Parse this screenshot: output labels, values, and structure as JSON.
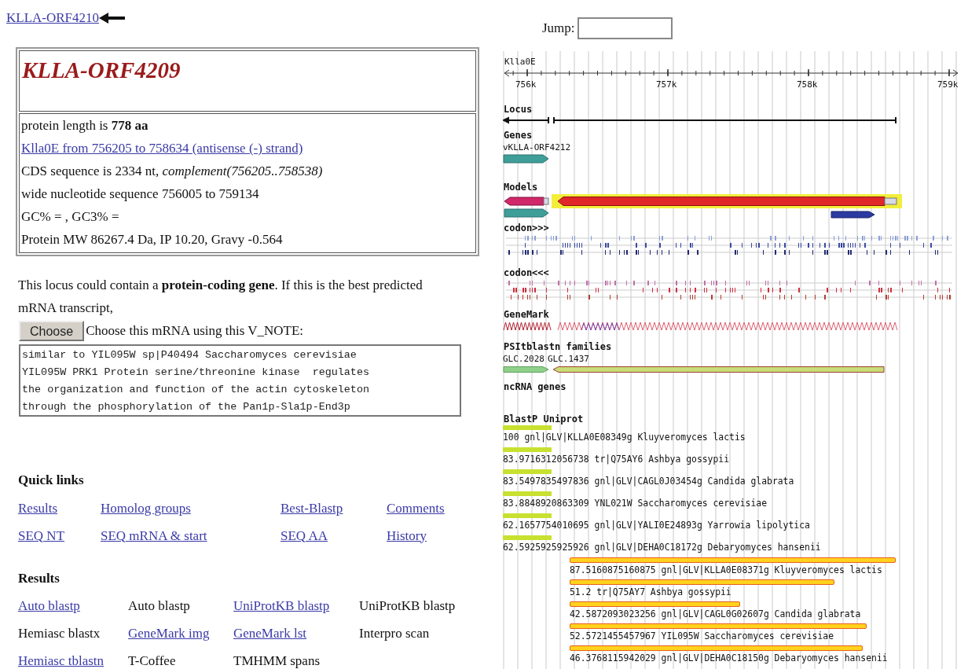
{
  "nav_link": "KLLA-ORF4210",
  "summary": {
    "title": "KLLA-ORF4209",
    "lines": [
      {
        "kind": "text",
        "text": "protein length is **778 aa**"
      },
      {
        "kind": "link",
        "text": "Klla0E from 756205 to 758634 (antisense (-) strand)"
      },
      {
        "kind": "text",
        "text": "CDS sequence is 2334 nt, *complement(756205..758538)*"
      },
      {
        "kind": "text",
        "text": "wide nucleotide sequence 756005 to 759134"
      },
      {
        "kind": "text",
        "text": "GC% = , GC3% ="
      },
      {
        "kind": "text",
        "text": "Protein MW 86267.4 Da, IP 10.20, Gravy -0.564"
      }
    ]
  },
  "description": "This locus could contain a **protein-coding gene**. If this is the best predicted mRNA transcript,",
  "choose": {
    "button": "Choose",
    "label": "Choose this mRNA using this V_NOTE:"
  },
  "note": "similar to YIL095W sp|P40494 Saccharomyces cerevisiae\nYIL095W PRK1 Protein serine/threonine kinase  regulates\nthe organization and function of the actin cytoskeleton\nthrough the phosphorylation of the Pan1p-Sla1p-End3p",
  "quick_links": {
    "heading": "Quick links",
    "rows": [
      [
        {
          "text": "Results",
          "link": true
        },
        {
          "text": "Homolog groups",
          "link": true
        },
        {
          "text": "Best-Blastp",
          "link": true
        },
        {
          "text": "Comments",
          "link": true
        }
      ],
      [
        {
          "text": "SEQ NT",
          "link": true
        },
        {
          "text": "SEQ mRNA & start",
          "link": true
        },
        {
          "text": "SEQ AA",
          "link": true
        },
        {
          "text": "History",
          "link": true
        }
      ]
    ]
  },
  "results": {
    "heading": "Results",
    "rows": [
      [
        {
          "text": "Auto blastp",
          "link": true
        },
        {
          "text": "Auto blastp",
          "link": false
        },
        {
          "text": "UniProtKB blastp",
          "link": true
        },
        {
          "text": "UniProtKB blastp",
          "link": false
        }
      ],
      [
        {
          "text": "Hemiasc blastx",
          "link": false
        },
        {
          "text": "GeneMark img",
          "link": true
        },
        {
          "text": "GeneMark lst",
          "link": true
        },
        {
          "text": "Interpro scan",
          "link": false
        }
      ],
      [
        {
          "text": "Hemiasc tblastn",
          "link": true
        },
        {
          "text": "T-Coffee",
          "link": false
        },
        {
          "text": "TMHMM spans",
          "link": false
        }
      ]
    ]
  },
  "jump": {
    "label": "Jump:"
  },
  "browser": {
    "chromosome": "Klla0E",
    "ticks": [
      "756k",
      "757k",
      "758k",
      "759k"
    ],
    "tracks": [
      {
        "kind": "locus",
        "title": "Locus"
      },
      {
        "kind": "genes",
        "title": "Genes",
        "labels": [
          "vKLLA-ORF4212"
        ]
      },
      {
        "kind": "models",
        "title": "Models"
      },
      {
        "kind": "codon_forward",
        "title": "codon>>>"
      },
      {
        "kind": "codon_reverse",
        "title": "codon<<<"
      },
      {
        "kind": "genemark",
        "title": "GeneMark"
      },
      {
        "kind": "families",
        "title": "PSItblastn families",
        "labels": [
          "GLC.2028",
          "GLC.1437"
        ]
      },
      {
        "kind": "empty",
        "title": "ncRNA genes"
      },
      {
        "kind": "hits",
        "title": "BlastP Uniprot",
        "hits": [
          {
            "kind": "lead",
            "label": "100 gnl|GLV|KLLA0E08349g Kluyveromyces lactis"
          },
          {
            "kind": "lead",
            "label": "83.9716312056738 tr|Q75AY6 Ashbya gossypii"
          },
          {
            "kind": "lead",
            "label": "83.5497835497836 gnl|GLV|CAGL0J03454g Candida glabrata"
          },
          {
            "kind": "lead",
            "label": "83.8848920863309 YNL021W Saccharomyces cerevisiae"
          },
          {
            "kind": "lead",
            "label": "62.1657754010695 gnl|GLV|YALI0E24893g Yarrowia lipolytica"
          },
          {
            "kind": "lead",
            "label": "62.5925925925926 gnl|GLV|DEHA0C18172g Debaryomyces hansenii"
          },
          {
            "kind": "main",
            "label": "87.5160875160875 gnl|GLV|KLLA0E08371g Kluyveromyces lactis"
          },
          {
            "kind": "main",
            "label": "51.2 tr|Q75AY7 Ashbya gossypii"
          },
          {
            "kind": "main",
            "label": "42.5872093023256 gnl|GLV|CAGL0G02607g Candida glabrata"
          },
          {
            "kind": "main",
            "label": "52.5721455457967 YIL095W Saccharomyces cerevisiae"
          },
          {
            "kind": "main",
            "label": "46.3768115942029 gnl|GLV|DEHA0C18150g Debaryomyces hansenii"
          }
        ]
      }
    ]
  }
}
